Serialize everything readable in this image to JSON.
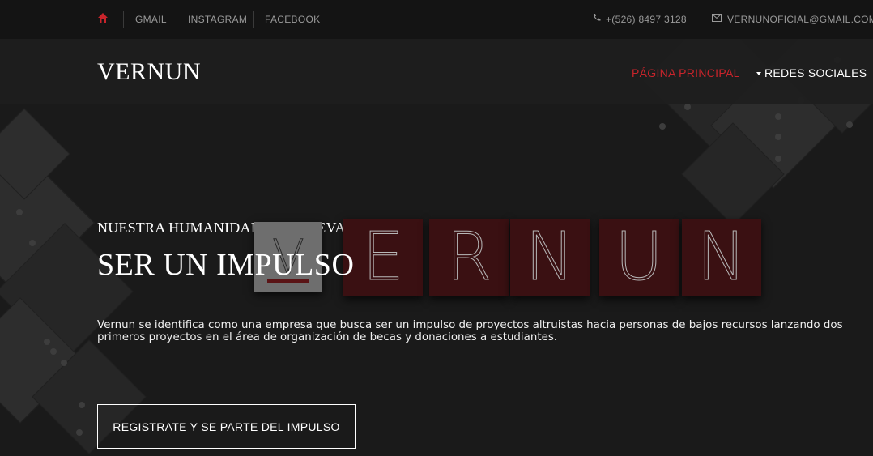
{
  "topbar": {
    "links": [
      "GMAIL",
      "INSTAGRAM",
      "FACEBOOK"
    ],
    "phone": "+(526) 8497 3128",
    "email": "VERNUNOFICIAL@GMAIL.COM"
  },
  "header": {
    "logo": "VERNUN",
    "nav_main": "PÁGINA PRINCIPAL",
    "nav_social": "REDES SOCIALES"
  },
  "hero": {
    "subtitle": "NUESTRA HUMANIDAD NOS LLEVA A",
    "title": "SER UN IMPULSO",
    "description": "Vernun se identifica como una empresa que busca ser un impulso de proyectos altruistas hacia personas de bajos recursos lanzando dos primeros proyectos en el área de organización de becas y donaciones a estudiantes.",
    "cta": "REGISTRATE Y SE PARTE DEL IMPULSO",
    "logo_letters": [
      "V",
      "E",
      "R",
      "N",
      "U",
      "N"
    ]
  },
  "colors": {
    "accent": "#c9242b",
    "background": "#1a1a1a",
    "tile": "#3a1012"
  }
}
